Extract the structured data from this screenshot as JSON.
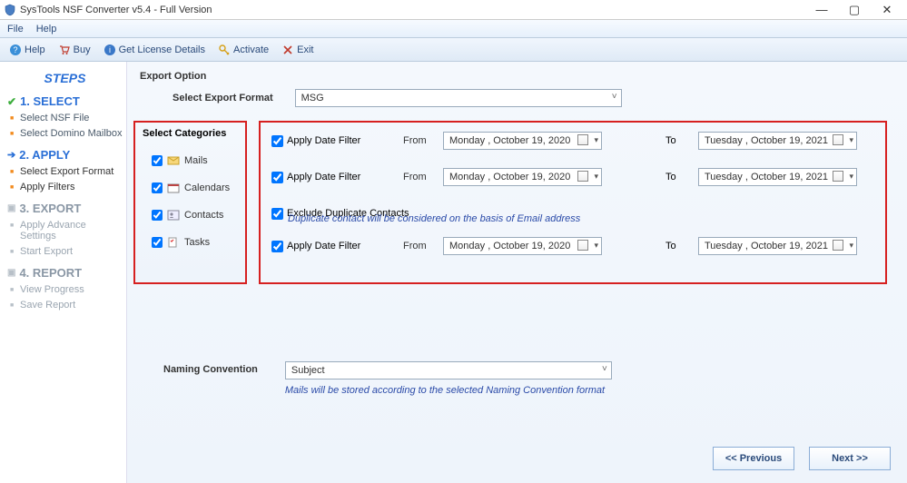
{
  "window": {
    "title": "SysTools NSF Converter v5.4 - Full Version"
  },
  "menu": {
    "file": "File",
    "help": "Help"
  },
  "toolbar": {
    "help": "Help",
    "buy": "Buy",
    "license": "Get License Details",
    "activate": "Activate",
    "exit": "Exit"
  },
  "sidebar": {
    "header": "STEPS",
    "step1": {
      "title": "1. SELECT",
      "items": [
        "Select NSF File",
        "Select Domino Mailbox"
      ]
    },
    "step2": {
      "title": "2. APPLY",
      "items": [
        "Select Export Format",
        "Apply Filters"
      ]
    },
    "step3": {
      "title": "3. EXPORT",
      "items": [
        "Apply Advance Settings",
        "Start Export"
      ]
    },
    "step4": {
      "title": "4. REPORT",
      "items": [
        "View Progress",
        "Save Report"
      ]
    }
  },
  "export": {
    "group": "Export Option",
    "label": "Select Export Format",
    "value": "MSG"
  },
  "categories": {
    "header": "Select Categories",
    "mails": "Mails",
    "calendars": "Calendars",
    "contacts": "Contacts",
    "tasks": "Tasks"
  },
  "filters": {
    "apply": "Apply Date Filter",
    "from": "From",
    "to": "To",
    "fromDate": "Monday   ,   October   19, 2020",
    "toDate": "Tuesday  ,   October   19, 2021",
    "excludeDup": "Exclude Duplicate Contacts",
    "dupNote": "Duplicate contact will be considered on the basis of Email address"
  },
  "naming": {
    "label": "Naming Convention",
    "value": "Subject",
    "note": "Mails will be stored according to the selected Naming Convention format"
  },
  "buttons": {
    "prev": "<< Previous",
    "next": "Next >>"
  }
}
